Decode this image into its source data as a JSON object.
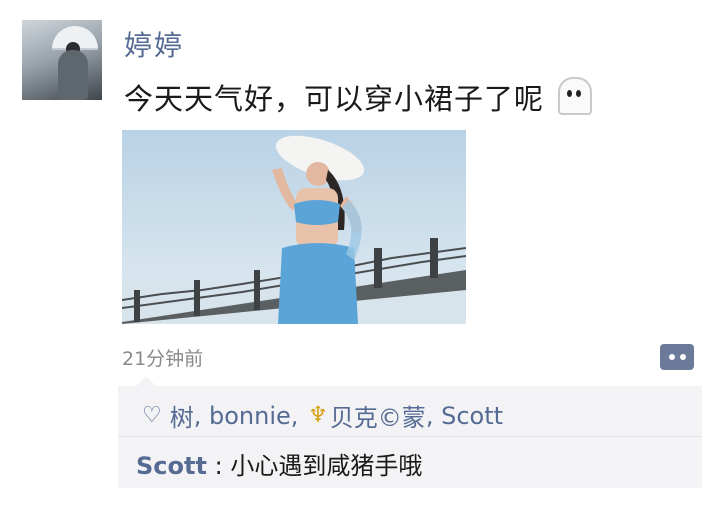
{
  "post": {
    "author": "婷婷",
    "text": "今天天气好，可以穿小裙子了呢",
    "emoji": "ghost-icon",
    "timestamp": "21分钟前"
  },
  "likes": {
    "icon": "heart-outline-icon",
    "names": [
      "树",
      "bonnie",
      "贝克©蒙",
      "Scott"
    ],
    "separator": ",",
    "trident_icon": "trident-icon"
  },
  "comments": [
    {
      "author": "Scott",
      "separator": ":",
      "text": "小心遇到咸猪手哦"
    }
  ],
  "colors": {
    "link": "#566b94",
    "panel_bg": "#f3f3f5",
    "button_bg": "#6b7a99",
    "trident": "#d4a017"
  }
}
